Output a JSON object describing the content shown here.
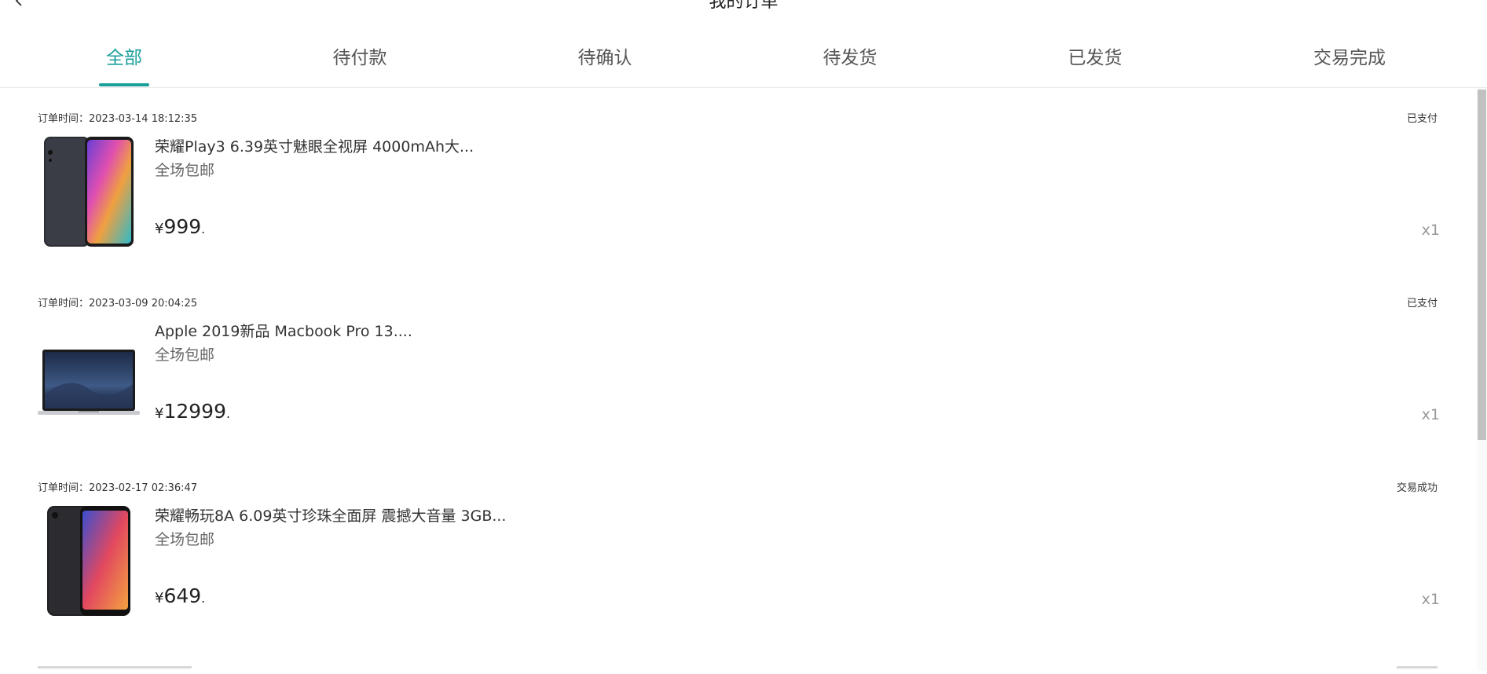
{
  "header": {
    "title": "我的订单",
    "back_icon": "chevron-left-icon",
    "more_label": "···"
  },
  "tabs": [
    {
      "label": "全部",
      "active": true
    },
    {
      "label": "待付款",
      "active": false
    },
    {
      "label": "待确认",
      "active": false
    },
    {
      "label": "待发货",
      "active": false
    },
    {
      "label": "已发货",
      "active": false
    },
    {
      "label": "交易完成",
      "active": false
    }
  ],
  "accent_color": "#1a9f9a",
  "orders": [
    {
      "time_label": "订单时间：",
      "time": "2023-03-14 18:12:35",
      "status": "已支付",
      "title": "荣耀Play3 6.39英寸魅眼全视屏 4000mAh大...",
      "shipping": "全场包邮",
      "currency": "¥",
      "price": "999",
      "price_suffix": ".",
      "qty": "x1",
      "thumb_icon": "phone-product-icon"
    },
    {
      "time_label": "订单时间：",
      "time": "2023-03-09 20:04:25",
      "status": "已支付",
      "title": "Apple 2019新品 Macbook Pro 13....",
      "shipping": "全场包邮",
      "currency": "¥",
      "price": "12999",
      "price_suffix": ".",
      "qty": "x1",
      "thumb_icon": "laptop-product-icon"
    },
    {
      "time_label": "订单时间：",
      "time": "2023-02-17 02:36:47",
      "status": "交易成功",
      "title": "荣耀畅玩8A 6.09英寸珍珠全面屏 震撼大音量 3GB...",
      "shipping": "全场包邮",
      "currency": "¥",
      "price": "649",
      "price_suffix": ".",
      "qty": "x1",
      "thumb_icon": "phone-product-icon"
    }
  ]
}
